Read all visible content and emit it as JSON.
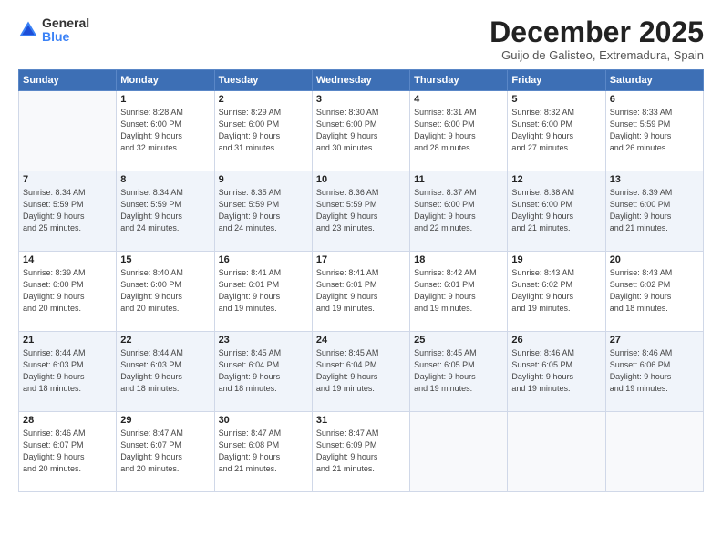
{
  "logo": {
    "general": "General",
    "blue": "Blue"
  },
  "header": {
    "month": "December 2025",
    "location": "Guijo de Galisteo, Extremadura, Spain"
  },
  "weekdays": [
    "Sunday",
    "Monday",
    "Tuesday",
    "Wednesday",
    "Thursday",
    "Friday",
    "Saturday"
  ],
  "weeks": [
    [
      {
        "day": "",
        "info": ""
      },
      {
        "day": "1",
        "info": "Sunrise: 8:28 AM\nSunset: 6:00 PM\nDaylight: 9 hours\nand 32 minutes."
      },
      {
        "day": "2",
        "info": "Sunrise: 8:29 AM\nSunset: 6:00 PM\nDaylight: 9 hours\nand 31 minutes."
      },
      {
        "day": "3",
        "info": "Sunrise: 8:30 AM\nSunset: 6:00 PM\nDaylight: 9 hours\nand 30 minutes."
      },
      {
        "day": "4",
        "info": "Sunrise: 8:31 AM\nSunset: 6:00 PM\nDaylight: 9 hours\nand 28 minutes."
      },
      {
        "day": "5",
        "info": "Sunrise: 8:32 AM\nSunset: 6:00 PM\nDaylight: 9 hours\nand 27 minutes."
      },
      {
        "day": "6",
        "info": "Sunrise: 8:33 AM\nSunset: 5:59 PM\nDaylight: 9 hours\nand 26 minutes."
      }
    ],
    [
      {
        "day": "7",
        "info": "Sunrise: 8:34 AM\nSunset: 5:59 PM\nDaylight: 9 hours\nand 25 minutes."
      },
      {
        "day": "8",
        "info": "Sunrise: 8:34 AM\nSunset: 5:59 PM\nDaylight: 9 hours\nand 24 minutes."
      },
      {
        "day": "9",
        "info": "Sunrise: 8:35 AM\nSunset: 5:59 PM\nDaylight: 9 hours\nand 24 minutes."
      },
      {
        "day": "10",
        "info": "Sunrise: 8:36 AM\nSunset: 5:59 PM\nDaylight: 9 hours\nand 23 minutes."
      },
      {
        "day": "11",
        "info": "Sunrise: 8:37 AM\nSunset: 6:00 PM\nDaylight: 9 hours\nand 22 minutes."
      },
      {
        "day": "12",
        "info": "Sunrise: 8:38 AM\nSunset: 6:00 PM\nDaylight: 9 hours\nand 21 minutes."
      },
      {
        "day": "13",
        "info": "Sunrise: 8:39 AM\nSunset: 6:00 PM\nDaylight: 9 hours\nand 21 minutes."
      }
    ],
    [
      {
        "day": "14",
        "info": "Sunrise: 8:39 AM\nSunset: 6:00 PM\nDaylight: 9 hours\nand 20 minutes."
      },
      {
        "day": "15",
        "info": "Sunrise: 8:40 AM\nSunset: 6:00 PM\nDaylight: 9 hours\nand 20 minutes."
      },
      {
        "day": "16",
        "info": "Sunrise: 8:41 AM\nSunset: 6:01 PM\nDaylight: 9 hours\nand 19 minutes."
      },
      {
        "day": "17",
        "info": "Sunrise: 8:41 AM\nSunset: 6:01 PM\nDaylight: 9 hours\nand 19 minutes."
      },
      {
        "day": "18",
        "info": "Sunrise: 8:42 AM\nSunset: 6:01 PM\nDaylight: 9 hours\nand 19 minutes."
      },
      {
        "day": "19",
        "info": "Sunrise: 8:43 AM\nSunset: 6:02 PM\nDaylight: 9 hours\nand 19 minutes."
      },
      {
        "day": "20",
        "info": "Sunrise: 8:43 AM\nSunset: 6:02 PM\nDaylight: 9 hours\nand 18 minutes."
      }
    ],
    [
      {
        "day": "21",
        "info": "Sunrise: 8:44 AM\nSunset: 6:03 PM\nDaylight: 9 hours\nand 18 minutes."
      },
      {
        "day": "22",
        "info": "Sunrise: 8:44 AM\nSunset: 6:03 PM\nDaylight: 9 hours\nand 18 minutes."
      },
      {
        "day": "23",
        "info": "Sunrise: 8:45 AM\nSunset: 6:04 PM\nDaylight: 9 hours\nand 18 minutes."
      },
      {
        "day": "24",
        "info": "Sunrise: 8:45 AM\nSunset: 6:04 PM\nDaylight: 9 hours\nand 19 minutes."
      },
      {
        "day": "25",
        "info": "Sunrise: 8:45 AM\nSunset: 6:05 PM\nDaylight: 9 hours\nand 19 minutes."
      },
      {
        "day": "26",
        "info": "Sunrise: 8:46 AM\nSunset: 6:05 PM\nDaylight: 9 hours\nand 19 minutes."
      },
      {
        "day": "27",
        "info": "Sunrise: 8:46 AM\nSunset: 6:06 PM\nDaylight: 9 hours\nand 19 minutes."
      }
    ],
    [
      {
        "day": "28",
        "info": "Sunrise: 8:46 AM\nSunset: 6:07 PM\nDaylight: 9 hours\nand 20 minutes."
      },
      {
        "day": "29",
        "info": "Sunrise: 8:47 AM\nSunset: 6:07 PM\nDaylight: 9 hours\nand 20 minutes."
      },
      {
        "day": "30",
        "info": "Sunrise: 8:47 AM\nSunset: 6:08 PM\nDaylight: 9 hours\nand 21 minutes."
      },
      {
        "day": "31",
        "info": "Sunrise: 8:47 AM\nSunset: 6:09 PM\nDaylight: 9 hours\nand 21 minutes."
      },
      {
        "day": "",
        "info": ""
      },
      {
        "day": "",
        "info": ""
      },
      {
        "day": "",
        "info": ""
      }
    ]
  ]
}
